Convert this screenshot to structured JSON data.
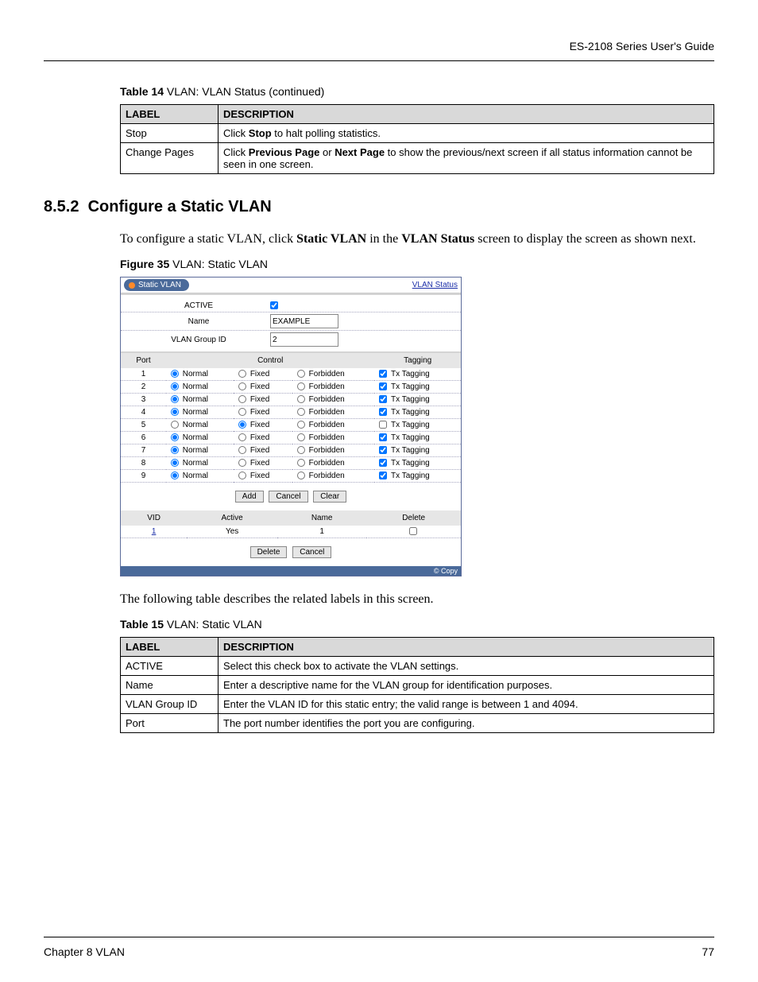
{
  "header": {
    "guide": "ES-2108 Series User's Guide"
  },
  "table14": {
    "caption_bold": "Table 14",
    "caption_rest": "   VLAN: VLAN Status  (continued)",
    "head_label": "LABEL",
    "head_desc": "DESCRIPTION",
    "rows": [
      {
        "label": "Stop",
        "desc_pre": "Click ",
        "desc_b1": "Stop",
        "desc_post": " to halt polling statistics."
      },
      {
        "label": "Change Pages",
        "desc_pre": "Click ",
        "desc_b1": "Previous Page",
        "desc_mid": " or ",
        "desc_b2": "Next Page",
        "desc_post": " to show the previous/next screen if all status information cannot be seen in one screen."
      }
    ]
  },
  "section": {
    "number": "8.5.2",
    "title": "Configure a Static VLAN",
    "intro_pre": "To configure a static VLAN, click ",
    "intro_b1": "Static VLAN",
    "intro_mid": " in the ",
    "intro_b2": "VLAN Status",
    "intro_post": " screen to display the screen as shown next."
  },
  "figure35": {
    "caption_bold": "Figure 35",
    "caption_rest": "   VLAN: Static VLAN",
    "title_pill": "Static VLAN",
    "title_link": "VLAN Status",
    "form": {
      "active_label": "ACTIVE",
      "active_checked": true,
      "name_label": "Name",
      "name_value": "EXAMPLE",
      "group_label": "VLAN Group ID",
      "group_value": "2"
    },
    "port_head": {
      "port": "Port",
      "control": "Control",
      "tagging": "Tagging"
    },
    "control_labels": {
      "normal": "Normal",
      "fixed": "Fixed",
      "forbidden": "Forbidden"
    },
    "tag_label": "Tx Tagging",
    "ports": [
      {
        "num": "1",
        "sel": "normal",
        "tag": true
      },
      {
        "num": "2",
        "sel": "normal",
        "tag": true
      },
      {
        "num": "3",
        "sel": "normal",
        "tag": true
      },
      {
        "num": "4",
        "sel": "normal",
        "tag": true
      },
      {
        "num": "5",
        "sel": "fixed",
        "tag": false
      },
      {
        "num": "6",
        "sel": "normal",
        "tag": true
      },
      {
        "num": "7",
        "sel": "normal",
        "tag": true
      },
      {
        "num": "8",
        "sel": "normal",
        "tag": true
      },
      {
        "num": "9",
        "sel": "normal",
        "tag": true
      }
    ],
    "buttons1": {
      "add": "Add",
      "cancel": "Cancel",
      "clear": "Clear"
    },
    "list_head": {
      "vid": "VID",
      "active": "Active",
      "name": "Name",
      "delete": "Delete"
    },
    "list_rows": [
      {
        "vid": "1",
        "active": "Yes",
        "name": "1",
        "del": false
      }
    ],
    "buttons2": {
      "delete": "Delete",
      "cancel": "Cancel"
    },
    "copy": "© Copy"
  },
  "after_figure": "The following table describes the related labels in this screen.",
  "table15": {
    "caption_bold": "Table 15",
    "caption_rest": "   VLAN: Static VLAN",
    "head_label": "LABEL",
    "head_desc": "DESCRIPTION",
    "rows": [
      {
        "label": "ACTIVE",
        "desc": "Select this check box to activate the VLAN settings."
      },
      {
        "label": "Name",
        "desc": "Enter a descriptive name for the VLAN group for identification purposes."
      },
      {
        "label": "VLAN Group ID",
        "desc": "Enter the VLAN ID for this static entry; the valid range is between 1 and 4094."
      },
      {
        "label": "Port",
        "desc": "The port number identifies the port you are configuring."
      }
    ]
  },
  "footer": {
    "chapter": "Chapter 8 VLAN",
    "page": "77"
  }
}
